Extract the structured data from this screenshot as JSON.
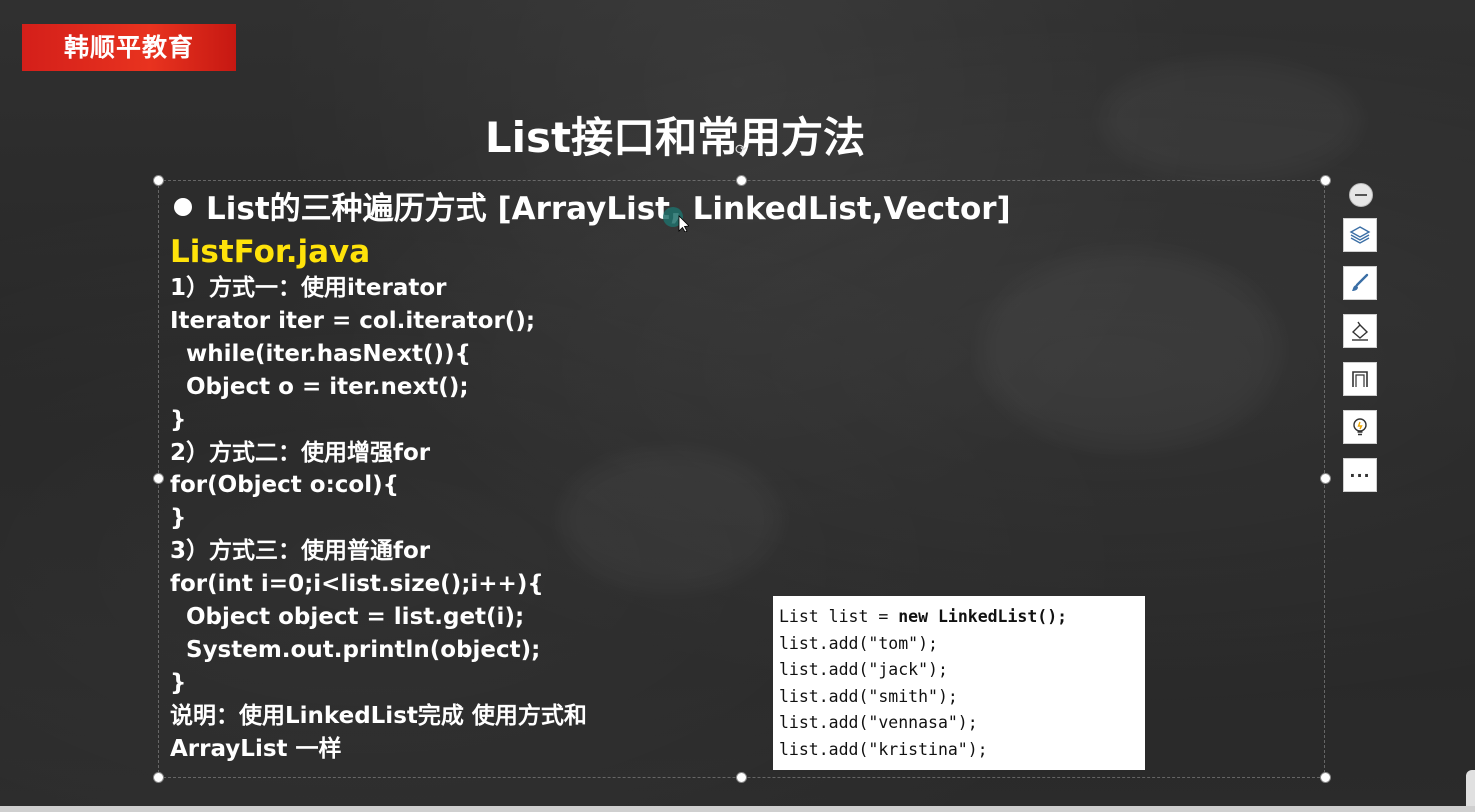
{
  "brand": {
    "label": "韩顺平教育"
  },
  "slide": {
    "title": "List接口和常用方法",
    "bullet": "List的三种遍历方式 [ArrayList, LinkedList,Vector]",
    "file_name": "ListFor.java",
    "lines": [
      {
        "text": "1）方式一：使用iterator",
        "indent": false
      },
      {
        "text": "Iterator iter = col.iterator();",
        "indent": false
      },
      {
        "text": "while(iter.hasNext()){",
        "indent": true
      },
      {
        "text": "Object o = iter.next();",
        "indent": true
      },
      {
        "text": "}",
        "indent": false
      },
      {
        "text": "2）方式二：使用增强for",
        "indent": false
      },
      {
        "text": "for(Object o:col){",
        "indent": false
      },
      {
        "text": "}",
        "indent": false
      },
      {
        "text": "3）方式三：使用普通for",
        "indent": false
      },
      {
        "text": "for(int i=0;i<list.size();i++){",
        "indent": false
      },
      {
        "text": "Object object = list.get(i);",
        "indent": true
      },
      {
        "text": "System.out.println(object);",
        "indent": true
      },
      {
        "text": "}",
        "indent": false
      },
      {
        "text": "说明：使用LinkedList完成 使用方式和",
        "indent": false
      },
      {
        "text": "ArrayList 一样",
        "indent": false
      }
    ]
  },
  "code_box": {
    "line1_prefix": "List list = ",
    "line1_keyword": "new LinkedList();",
    "lines": [
      "list.add(\"tom\");",
      "list.add(\"jack\");",
      "list.add(\"smith\");",
      "list.add(\"vennasa\");",
      "list.add(\"kristina\");"
    ]
  },
  "toolbar": {
    "items": [
      "collapse-icon",
      "layers-icon",
      "brush-icon",
      "fill-icon",
      "frame-icon",
      "lightbulb-icon",
      "more-icon"
    ],
    "more_label": "···"
  },
  "colors": {
    "brand_red": "#e02a1c",
    "file_name_yellow": "#ffe30a",
    "text_white": "#ffffff"
  }
}
